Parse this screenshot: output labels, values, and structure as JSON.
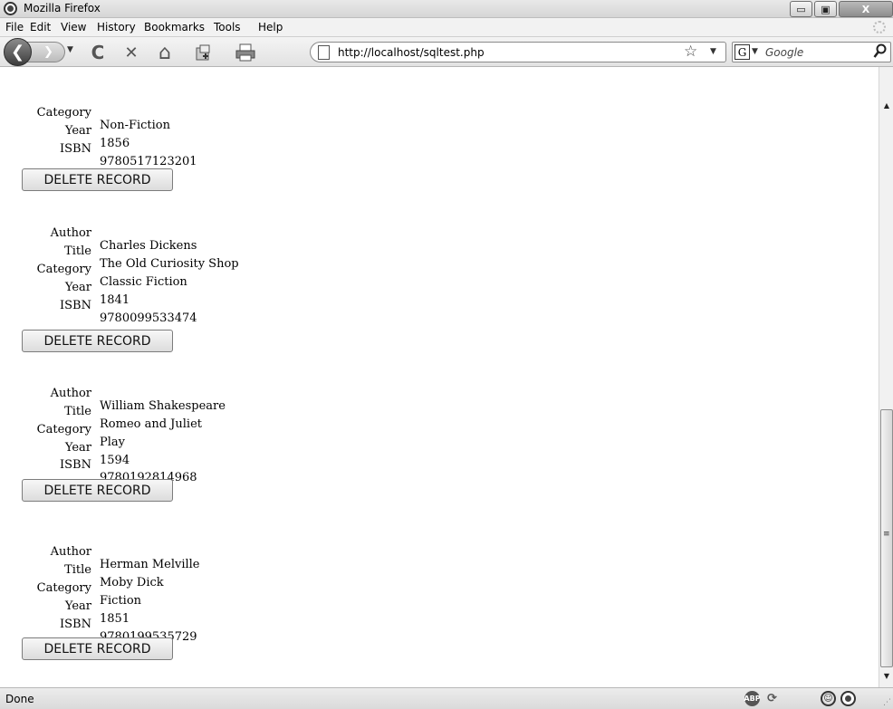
{
  "window": {
    "title": "Mozilla Firefox",
    "min_glyph": "▭",
    "max_glyph": "▣",
    "close_glyph": "X"
  },
  "menu": {
    "items": [
      "File",
      "Edit",
      "View",
      "History",
      "Bookmarks",
      "Tools",
      "Help"
    ]
  },
  "toolbar": {
    "back_glyph": "❮",
    "forward_glyph": "❯",
    "dropdown_glyph": "▼",
    "reload_glyph": "C",
    "stop_glyph": "✕",
    "home_glyph": "⌂",
    "url": "http://localhost/sqltest.php",
    "bookmark_star_glyph": "☆",
    "search_engine_glyph": "G",
    "search_placeholder": "Google",
    "search_go_glyph": "⚲"
  },
  "records": [
    {
      "fields": [
        {
          "label": "Category",
          "value": "Non-Fiction"
        },
        {
          "label": "Year",
          "value": "1856"
        },
        {
          "label": "ISBN",
          "value": "9780517123201"
        }
      ],
      "button": "DELETE RECORD"
    },
    {
      "fields": [
        {
          "label": "Author",
          "value": "Charles Dickens"
        },
        {
          "label": "Title",
          "value": "The Old Curiosity Shop"
        },
        {
          "label": "Category",
          "value": "Classic Fiction"
        },
        {
          "label": "Year",
          "value": "1841"
        },
        {
          "label": "ISBN",
          "value": "9780099533474"
        }
      ],
      "button": "DELETE RECORD"
    },
    {
      "fields": [
        {
          "label": "Author",
          "value": "William Shakespeare"
        },
        {
          "label": "Title",
          "value": "Romeo and Juliet"
        },
        {
          "label": "Category",
          "value": "Play"
        },
        {
          "label": "Year",
          "value": "1594"
        },
        {
          "label": "ISBN",
          "value": "9780192814968"
        }
      ],
      "button": "DELETE RECORD"
    },
    {
      "fields": [
        {
          "label": "Author",
          "value": "Herman Melville"
        },
        {
          "label": "Title",
          "value": "Moby Dick"
        },
        {
          "label": "Category",
          "value": "Fiction"
        },
        {
          "label": "Year",
          "value": "1851"
        },
        {
          "label": "ISBN",
          "value": "9780199535729"
        }
      ],
      "button": "DELETE RECORD"
    }
  ],
  "scrollbar": {
    "up_glyph": "▲",
    "down_glyph": "▼",
    "grip_glyph": "≡"
  },
  "status": {
    "text": "Done",
    "abp_label": "ABP",
    "cycle_glyph": "⟳",
    "smile_glyph": "☺",
    "resize_glyph": "⋰"
  }
}
